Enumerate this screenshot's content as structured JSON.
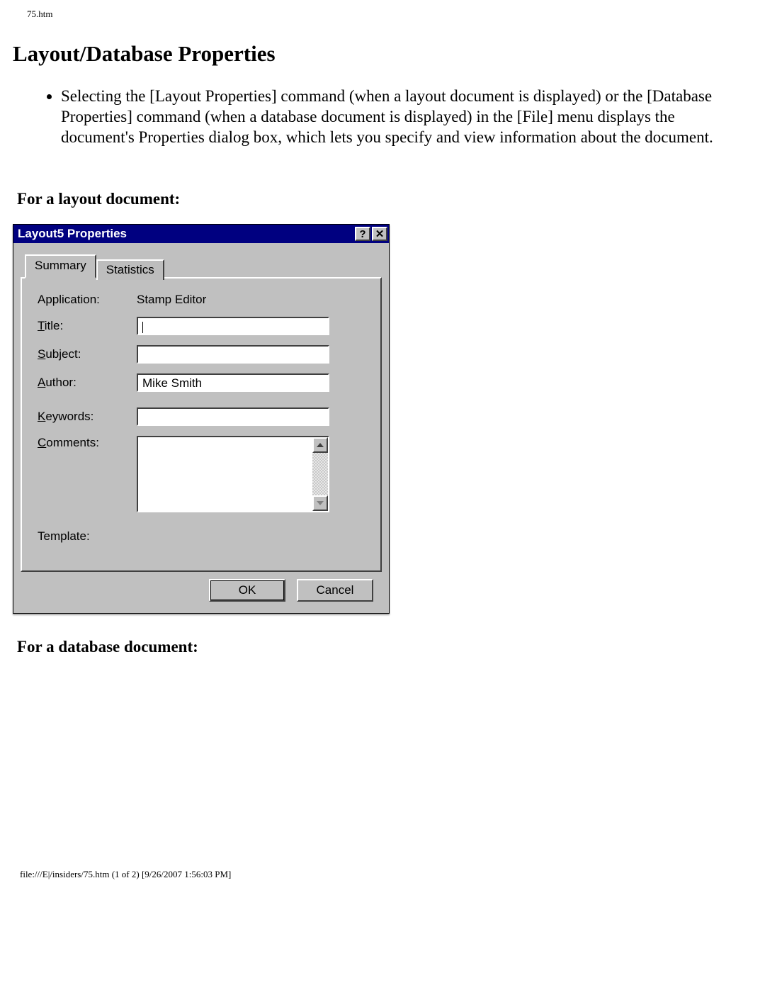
{
  "header_path": "75.htm",
  "page_title": "Layout/Database Properties",
  "intro_bullet": "Selecting the [Layout Properties] command (when a layout document is displayed) or the [Database Properties] command (when a database document is displayed) in the [File] menu displays the document's Properties dialog box, which lets you specify and view information about the document.",
  "section_layout": "For a layout document:",
  "section_database": "For a database document:",
  "dialog": {
    "title": "Layout5 Properties",
    "help_symbol": "?",
    "close_symbol": "✕",
    "tabs": {
      "summary": "Summary",
      "statistics": "Statistics"
    },
    "labels": {
      "application": "Application:",
      "title_prefix": "T",
      "title_rest": "itle:",
      "subject_prefix": "S",
      "subject_rest": "ubject:",
      "author_prefix": "A",
      "author_rest": "uthor:",
      "keywords_prefix": "K",
      "keywords_rest": "eywords:",
      "comments_prefix": "C",
      "comments_rest": "omments:",
      "template": "Template:"
    },
    "values": {
      "application": "Stamp Editor",
      "title": "",
      "subject": "",
      "author": "Mike Smith",
      "keywords": "",
      "comments": "",
      "template": ""
    },
    "buttons": {
      "ok": "OK",
      "cancel": "Cancel"
    }
  },
  "footer_path": "file:///E|/insiders/75.htm (1 of 2) [9/26/2007 1:56:03 PM]"
}
